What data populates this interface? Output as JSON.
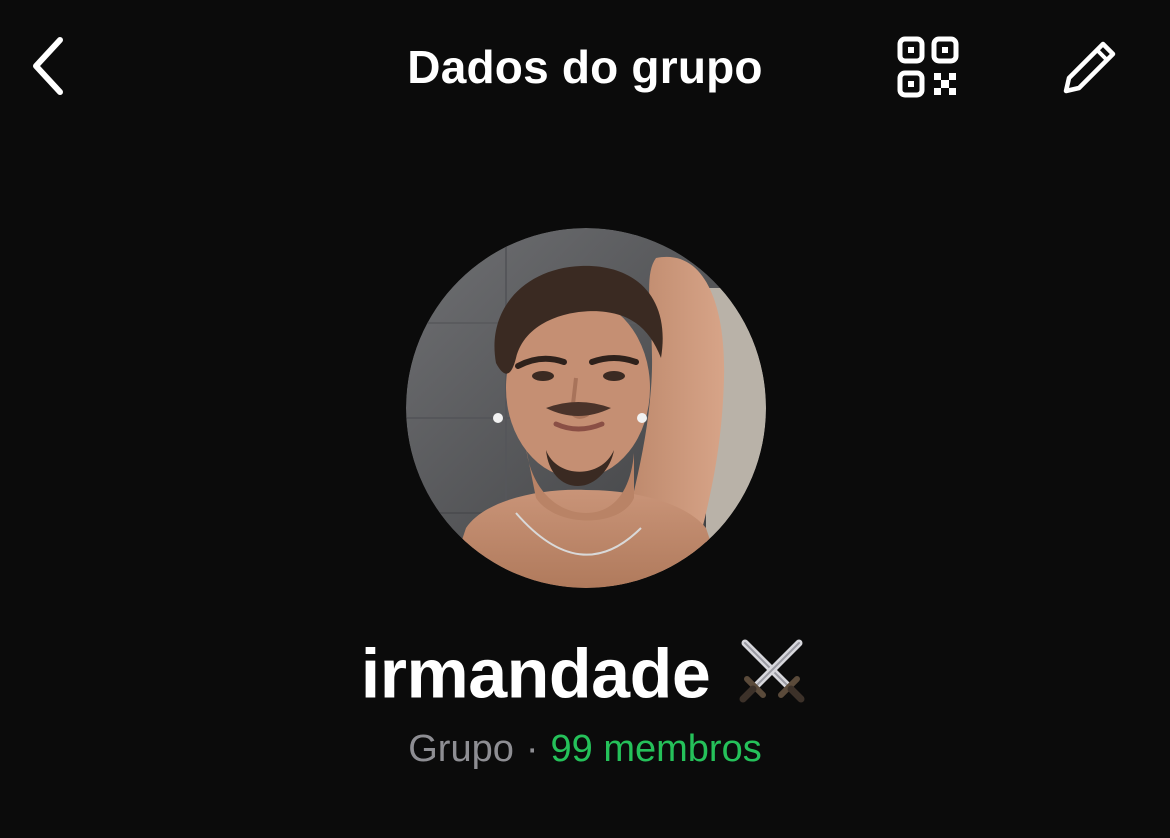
{
  "header": {
    "title": "Dados do grupo",
    "back_icon": "chevron-left-icon",
    "qr_icon": "qr-code-icon",
    "edit_icon": "pencil-icon"
  },
  "group": {
    "name": "irmandade",
    "name_emoji_icon": "crossed-swords-icon",
    "type_label": "Grupo",
    "separator": "·",
    "members_label": "99 membros"
  },
  "colors": {
    "background": "#0b0b0b",
    "text_primary": "#ffffff",
    "text_secondary": "#8e8e93",
    "accent_green": "#25c15a"
  }
}
